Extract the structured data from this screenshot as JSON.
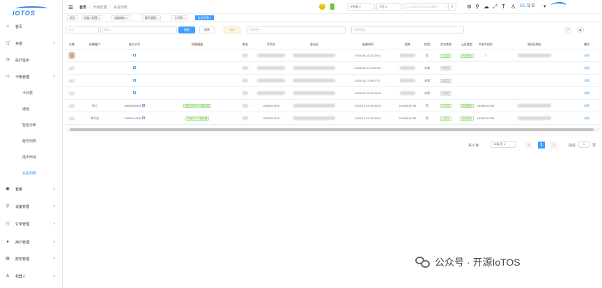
{
  "app": {
    "logo": "IOTOS"
  },
  "sidebar": {
    "items": [
      {
        "label": "首页",
        "icon": "home-icon",
        "glyph": "⌂",
        "arrow": ""
      },
      {
        "label": "充值",
        "icon": "cart-icon",
        "glyph": "🛒",
        "arrow": "∨"
      },
      {
        "label": "执行任务",
        "icon": "task-icon",
        "glyph": "◷",
        "arrow": ""
      },
      {
        "label": "卡板管理",
        "icon": "card-icon",
        "glyph": "▭",
        "arrow": "∧"
      }
    ],
    "sub": [
      "卡列表",
      "通道",
      "智能诊断",
      "靓号列表",
      "插卡申请",
      "实名列表"
    ],
    "items2": [
      {
        "label": "套餐",
        "icon": "package-icon",
        "glyph": "▣",
        "arrow": "∨"
      },
      {
        "label": "设备管理",
        "icon": "device-icon",
        "glyph": "⚲",
        "arrow": "∨"
      },
      {
        "label": "订单管理",
        "icon": "order-icon",
        "glyph": "🛒",
        "arrow": "∨"
      },
      {
        "label": "用户管理",
        "icon": "user-icon",
        "glyph": "●",
        "arrow": "∨"
      },
      {
        "label": "财务管理",
        "icon": "finance-icon",
        "glyph": "▤",
        "arrow": "∨"
      },
      {
        "label": "机器人",
        "icon": "robot-icon",
        "glyph": "♙",
        "arrow": "∨"
      }
    ]
  },
  "topbar": {
    "breadcrumb": [
      "首页",
      "卡板管理",
      "实名列表"
    ],
    "select1": "卡列表",
    "select2": "卡号",
    "search_placeholder": "ICCID/MSISDN/IMSI/靓号",
    "version": "81.5",
    "version_suffix": "| 0"
  },
  "tags": [
    "首页",
    "机器人配置",
    "机器储存",
    "聊天管理",
    "卡列表",
    "实名列表"
  ],
  "filters": {
    "f1": "卡号",
    "f2": "请输入",
    "search": "搜索",
    "reset": "重置",
    "export": "导出",
    "f3": "所属客户",
    "f4": "所属通道"
  },
  "table": {
    "headers": [
      "头像",
      "所属客户",
      "批方卡号",
      "所属通道",
      "姓名",
      "手机号",
      "身份证",
      "创建时间",
      "昵称",
      "性别",
      "实名状态",
      "认证类型",
      "实名手机号",
      "身份证地址",
      "操作"
    ],
    "rows": [
      {
        "customer": "",
        "card": "",
        "channel": "",
        "phone": "",
        "time": "2024-05-16 21:32:42",
        "nick": "",
        "sex": "男",
        "status": "已实名",
        "status_type": "green",
        "auth": "系统校验",
        "rphone": "1",
        "op": "详情"
      },
      {
        "customer": "",
        "card": "",
        "channel": "",
        "phone": "",
        "time": "2024-05-07 20:52:30",
        "nick": "",
        "sex": "未知",
        "status": "未实名",
        "status_type": "gray",
        "auth": "",
        "rphone": "",
        "op": "详情"
      },
      {
        "customer": "",
        "card": "",
        "channel": "",
        "phone": "",
        "time": "2024-03-14 09:07:37",
        "nick": "",
        "sex": "未知",
        "status": "未实名",
        "status_type": "gray",
        "auth": "",
        "rphone": "",
        "op": "详情"
      },
      {
        "customer": "",
        "card": "",
        "channel": "",
        "phone": "",
        "time": "2024-02-28 12:09:09",
        "nick": "",
        "sex": "未知",
        "status": "未实名",
        "status_type": "gray",
        "auth": "",
        "rphone": "",
        "op": "详情"
      },
      {
        "customer": "张工",
        "card": "18658000004",
        "channel": "电信CMP5G-中国电信",
        "phone": "13280014795",
        "time": "2023-12-28 15:08:34",
        "nick": "13280014795",
        "sex": "男",
        "status": "已实名",
        "status_type": "green",
        "auth": "系统校验",
        "rphone": "13280014795",
        "op": "详情"
      },
      {
        "customer": "李平台",
        "card": "13280014795",
        "channel": "联通5G0-中国联通",
        "phone": "13280014795",
        "time": "2023-12-28 15:08:34",
        "nick": "13280014795",
        "sex": "男",
        "status": "已实名",
        "status_type": "green",
        "auth": "系统校验",
        "rphone": "13280014795",
        "op": "详情"
      }
    ]
  },
  "pager": {
    "total": "共 6 条",
    "size": "10条/页",
    "page": "1",
    "goto": "前往",
    "goto_page": "1",
    "unit": "页"
  },
  "watermark": "公众号 · 开源IoTOS"
}
